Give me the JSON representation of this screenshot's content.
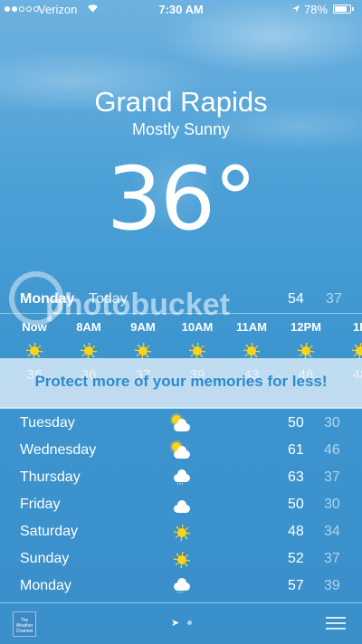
{
  "status_bar": {
    "carrier": "Verizon",
    "time": "7:30 AM",
    "battery_percent": "78%",
    "battery_level": 0.78,
    "signal_bars_filled": 2,
    "signal_bars_total": 5
  },
  "location": {
    "city": "Grand Rapids",
    "condition": "Mostly Sunny",
    "temperature": "36°"
  },
  "today": {
    "day": "Monday",
    "label": "Today",
    "high": "54",
    "low": "37"
  },
  "hourly": [
    {
      "time": "Now",
      "icon": "sun-icon",
      "temp": "36"
    },
    {
      "time": "8AM",
      "icon": "sun-icon",
      "temp": "36"
    },
    {
      "time": "9AM",
      "icon": "sun-icon",
      "temp": "37"
    },
    {
      "time": "10AM",
      "icon": "sun-icon",
      "temp": "39"
    },
    {
      "time": "11AM",
      "icon": "sun-icon",
      "temp": "43"
    },
    {
      "time": "12PM",
      "icon": "sun-icon",
      "temp": "46"
    },
    {
      "time": "1P",
      "icon": "sun-icon",
      "temp": "48"
    }
  ],
  "banner": {
    "text": "Protect more of your memories for less!"
  },
  "watermark": {
    "text": "photobucket"
  },
  "daily": [
    {
      "day": "Tuesday",
      "icon": "partly-cloudy-icon",
      "high": "50",
      "low": "30"
    },
    {
      "day": "Wednesday",
      "icon": "partly-cloudy-icon",
      "high": "61",
      "low": "46"
    },
    {
      "day": "Thursday",
      "icon": "rain-icon",
      "high": "63",
      "low": "37"
    },
    {
      "day": "Friday",
      "icon": "cloud-icon",
      "high": "50",
      "low": "30"
    },
    {
      "day": "Saturday",
      "icon": "sun-icon",
      "high": "48",
      "low": "34"
    },
    {
      "day": "Sunday",
      "icon": "sun-icon",
      "high": "52",
      "low": "37"
    },
    {
      "day": "Monday",
      "icon": "rain-icon",
      "high": "57",
      "low": "39"
    }
  ],
  "bottom_bar": {
    "logo_text": "The Weather Channel"
  },
  "colors": {
    "sky_top": "#6db2e0",
    "sky_bottom": "#3a8fc9",
    "sun": "#ffd21a",
    "banner_text": "#2a8bd1"
  }
}
